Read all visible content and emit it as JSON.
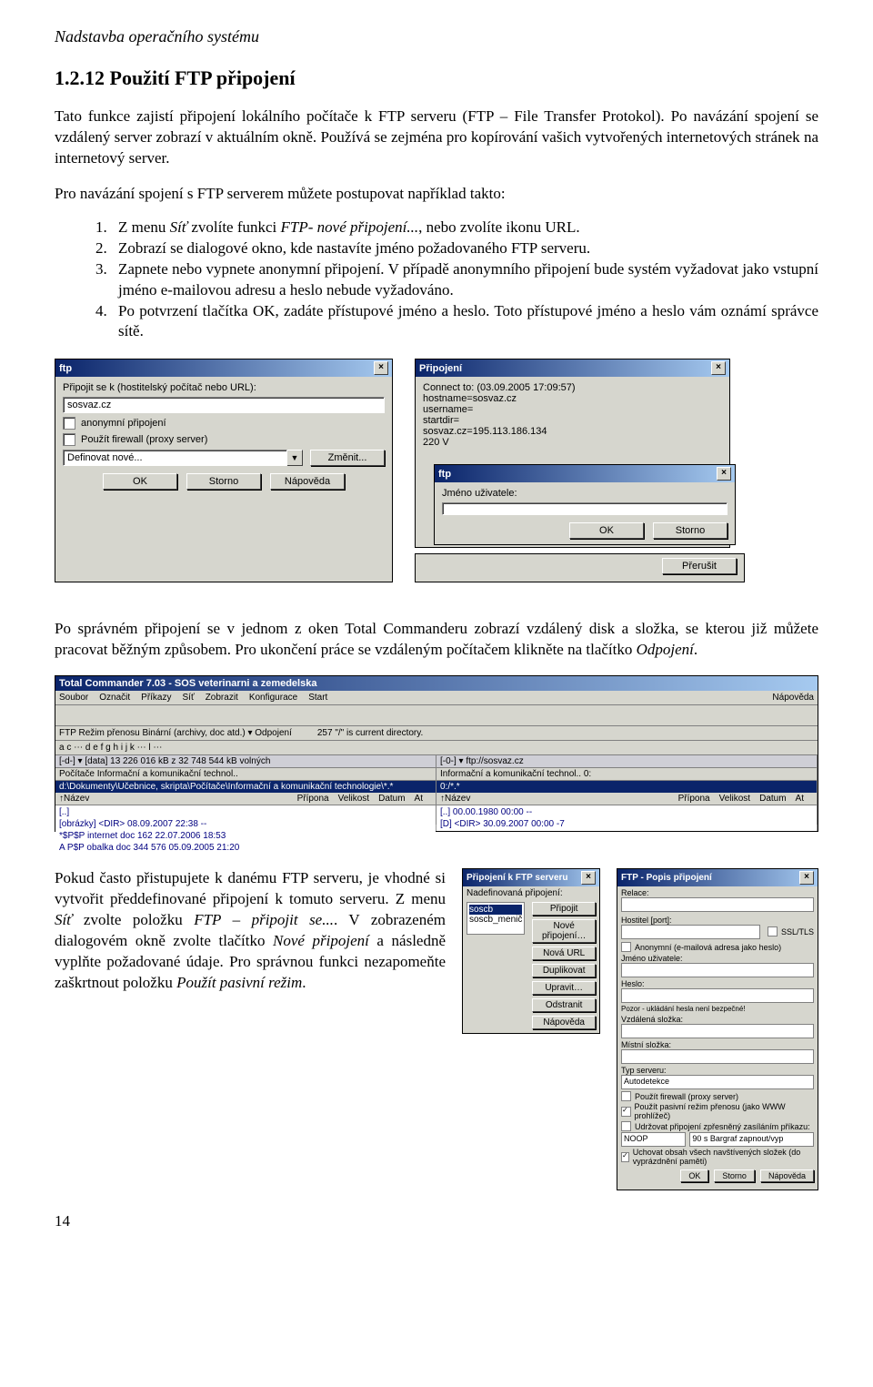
{
  "header": "Nadstavba operačního systému",
  "title": "1.2.12  Použití FTP připojení",
  "p1": "Tato funkce zajistí připojení lokálního počítače k FTP serveru (FTP – File Transfer Protokol). Po navázání spojení se vzdálený server zobrazí v aktuálním okně. Používá se zejména pro kopírování vašich vytvořených internetových stránek na internetový server.",
  "p2": "Pro navázání spojení s FTP serverem můžete postupovat například takto:",
  "steps": {
    "s1a": "Z menu ",
    "s1i": "Síť",
    "s1b": " zvolíte funkci ",
    "s1i2": "FTP- nové připojení...",
    "s1c": ", nebo zvolíte ikonu URL.",
    "s2": "Zobrazí se dialogové okno, kde nastavíte jméno požadovaného FTP serveru.",
    "s3": "Zapnete nebo vypnete anonymní připojení. V případě anonymního připojení bude systém vyžadovat jako vstupní jméno e-mailovou adresu a heslo nebude vyžadováno.",
    "s4": "Po potvrzení tlačítka OK, zadáte přístupové jméno a heslo. Toto přístupové jméno a heslo vám oznámí správce sítě."
  },
  "dlg1": {
    "title": "ftp",
    "label": "Připojit se k (hostitelský počítač nebo URL):",
    "host": "sosvaz.cz",
    "anon": "anonymní připojení",
    "fw": "Použít firewall (proxy server)",
    "combo": "Definovat nové...",
    "change": "Změnit...",
    "ok": "OK",
    "cancel": "Storno",
    "help": "Nápověda"
  },
  "dlg2": {
    "title": "Připojení",
    "line1": "Connect to: (03.09.2005 17:09:57)",
    "line2": "hostname=sosvaz.cz",
    "line3": "username=",
    "line4": "startdir=",
    "line5": "sosvaz.cz=195.113.186.134",
    "line6": "220 V",
    "sub_title": "ftp",
    "userlabel": "Jméno uživatele:",
    "ok": "OK",
    "cancel": "Storno",
    "interrupt": "Přerušit"
  },
  "p3a": "Po správném připojení se v jednom z oken Total Commanderu zobrazí vzdálený disk a složka, se kterou již můžete pracovat běžným způsobem. Pro ukončení práce se vzdáleným počítačem klikněte na tlačítko ",
  "p3i": "Odpojení",
  "p3b": ".",
  "tc": {
    "title": "Total Commander 7.03 - SOS veterinarni a zemedelska",
    "menu": [
      "Soubor",
      "Označit",
      "Příkazy",
      "Síť",
      "Zobrazit",
      "Konfigurace",
      "Start"
    ],
    "menu_right": "Nápověda",
    "ftp_row_left": "FTP      Režim přenosu  Binární (archivy, doc atd.)  ▾   Odpojení",
    "ftp_row_right": "257 \"/\" is current directory.",
    "drives": "a   c   ⋯   d   e   f   g   h   i   j   k   ⋯   l   ⋯",
    "left_head": "[-d-] ▾ [data]  13 226 016 kB z 32 748 544 kB volných",
    "right_head": "[-0-] ▾ ftp://sosvaz.cz",
    "left_tab": "Počítače   Informační a komunikační technol..",
    "right_tab": "Informační a komunikační technol..   0:",
    "left_path": "d:\\Dokumenty\\Učebnice, skripta\\Počítače\\Informační a komunikační technologie\\*.*",
    "right_path": "0:/*.*",
    "cols_left": [
      "↑Název",
      "Přípona",
      "Velikost",
      "Datum",
      "At"
    ],
    "cols_right": [
      "↑Název",
      "Přípona",
      "Velikost",
      "Datum",
      "At"
    ],
    "left_rows": [
      "[..]",
      "[obrázky]                                 <DIR>   08.09.2007 22:38 --",
      "*$P$P internet                 doc              162 22.07.2006 18:53",
      "A P$P obalka                   doc        344 576 05.09.2005 21:20"
    ],
    "left_rows_dir2": "<DIR>   08.09.2007 22:38 --",
    "right_rows": [
      "[..]                                                 00.00.1980 00:00 --",
      "[D]                                       <DIR>   30.09.2007 00:00 -7"
    ]
  },
  "p4a": "Pokud často přistupujete k danému FTP serveru, je vhodné si vytvořit předdefinované připojení k tomuto serveru. Z menu ",
  "p4i1": "Síť",
  "p4b": " zvolte položku ",
  "p4i2": "FTP – připojit se...",
  "p4c": ". V zobrazeném dialogovém okně zvolte tlačítko ",
  "p4i3": "Nové připojení",
  "p4d": " a následně vyplňte požadované údaje. Pro správnou funkci nezapomeňte zaškrtnout položku ",
  "p4i4": "Použít pasivní režim",
  "p4e": ".",
  "mini": {
    "title": "Připojení k FTP serveru",
    "label": "Nadefinovaná připojení:",
    "item1": "soscb",
    "item2": "soscb_menič",
    "btns": [
      "Připojit",
      "Nové připojení…",
      "Nová URL",
      "Duplikovat",
      "Upravit…",
      "Odstranit",
      "Nápověda"
    ]
  },
  "detail": {
    "title": "FTP - Popis připojení",
    "l1": "Relace:",
    "l2": "Hostitel [port]:",
    "chk_ssl": "SSL/TLS",
    "l3": "Anonymní (e-mailová adresa jako heslo)",
    "l4": "Jméno uživatele:",
    "l5": "Heslo:",
    "warn": "Pozor - ukládání hesla není bezpečné!",
    "l6": "Vzdálená složka:",
    "l7": "Místní složka:",
    "l8": "Typ serveru:",
    "combo": "Autodetekce",
    "c1": "Použít firewall (proxy server)",
    "c2": "Použít pasivní režim přenosu (jako WWW prohlížeč)",
    "c3": "Udržovat připojení zpřesněný zasíláním příkazu:",
    "noop": "NOOP",
    "sec": "90 s  Bargraf zapnout/vyp",
    "c4": "Uchovat obsah všech navštívených složek (do vyprázdnění paměti)",
    "ok": "OK",
    "cancel": "Storno",
    "help": "Nápověda"
  },
  "pagenum": "14"
}
